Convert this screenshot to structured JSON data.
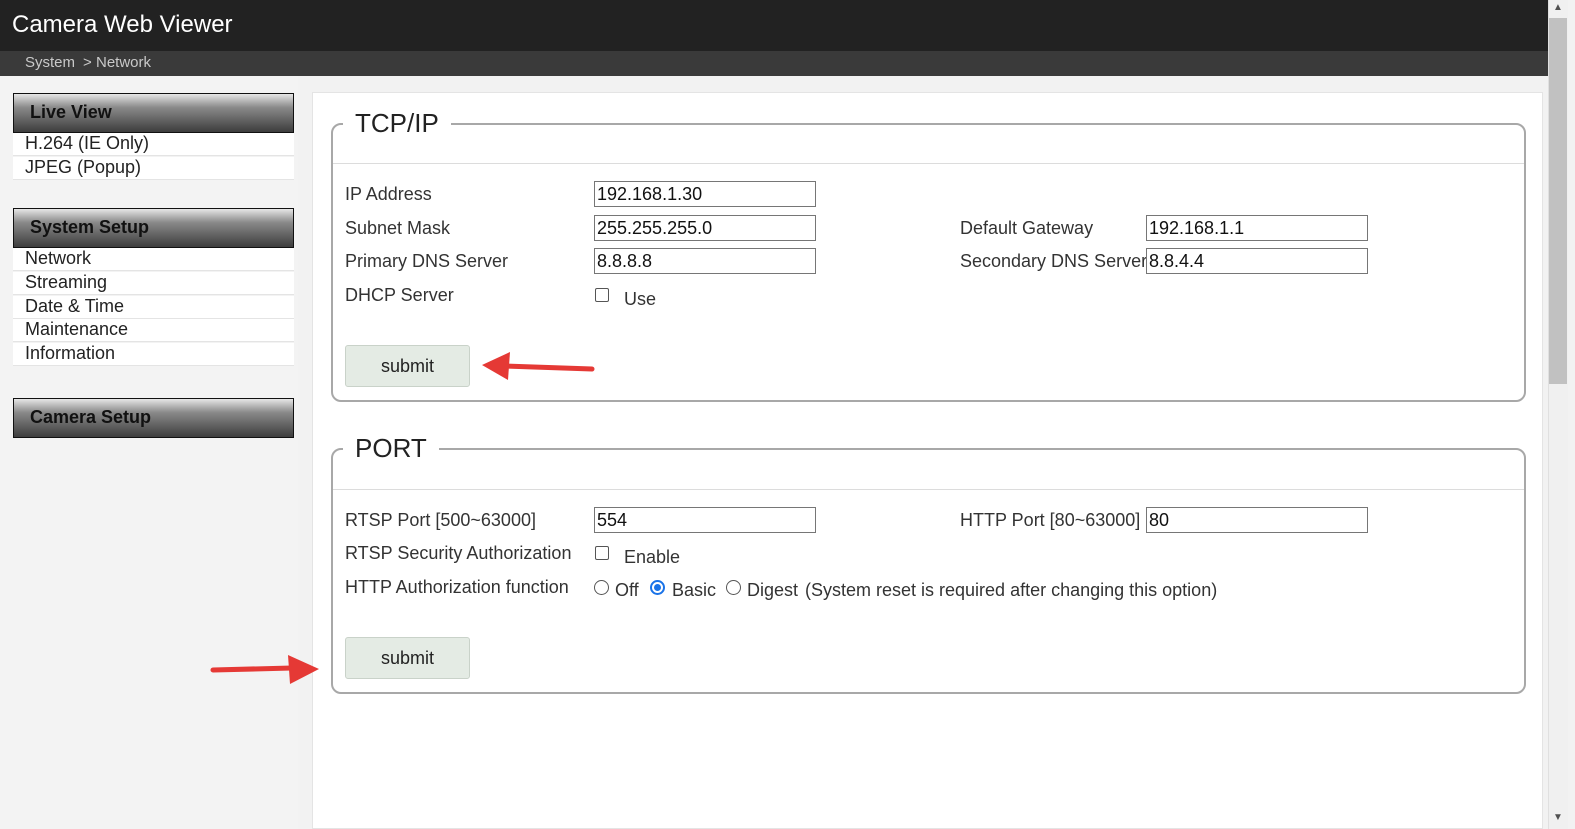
{
  "app": {
    "title": "Camera Web Viewer"
  },
  "breadcrumb": {
    "root": "System",
    "separator": ">",
    "current": "Network"
  },
  "sidebar": {
    "sections": [
      {
        "title": "Live View",
        "items": [
          "H.264 (IE Only)",
          "JPEG  (Popup)"
        ]
      },
      {
        "title": "System Setup",
        "items": [
          "Network",
          "Streaming",
          "Date & Time",
          "Maintenance",
          "Information"
        ]
      },
      {
        "title": "Camera Setup",
        "items": []
      }
    ]
  },
  "tcpip": {
    "legend": "TCP/IP",
    "ip_label": "IP Address",
    "ip_value": "192.168.1.30",
    "subnet_label": "Subnet Mask",
    "subnet_value": "255.255.255.0",
    "gateway_label": "Default Gateway",
    "gateway_value": "192.168.1.1",
    "dns1_label": "Primary DNS Server",
    "dns1_value": "8.8.8.8",
    "dns2_label": "Secondary DNS Server",
    "dns2_value": "8.8.4.4",
    "dhcp_label": "DHCP Server",
    "dhcp_option": "Use",
    "dhcp_checked": false,
    "submit_label": "submit"
  },
  "port": {
    "legend": "PORT",
    "rtsp_label": "RTSP Port [500~63000]",
    "rtsp_value": "554",
    "http_label": "HTTP Port [80~63000]",
    "http_value": "80",
    "rtsp_auth_label": "RTSP Security Authorization",
    "rtsp_auth_option": "Enable",
    "rtsp_auth_checked": false,
    "http_auth_label": "HTTP Authorization function",
    "http_auth_options": [
      "Off",
      "Basic",
      "Digest"
    ],
    "http_auth_selected": "Basic",
    "http_auth_note": "(System reset is required after changing this option)",
    "submit_label": "submit"
  },
  "annotations": {
    "arrow_color": "#e53935"
  }
}
